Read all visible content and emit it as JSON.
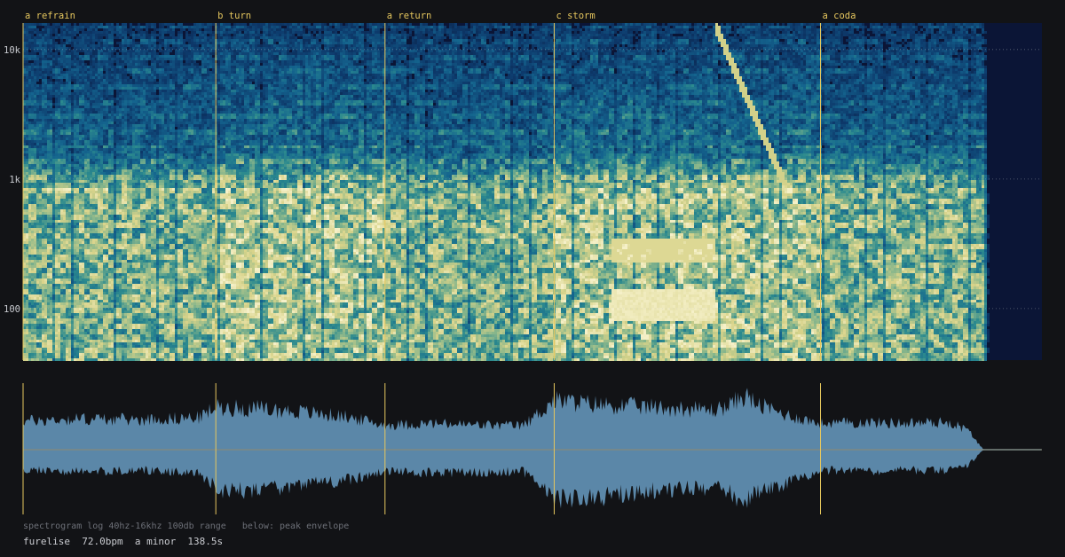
{
  "chart_data": [
    {
      "type": "heatmap",
      "colormap": [
        "#0a1a3c",
        "#0d3a6c",
        "#14648e",
        "#2c8a8e",
        "#8bb78b",
        "#d8d38a",
        "#f5f0c8"
      ],
      "x_range_seconds": [
        0,
        138.5
      ],
      "y_scale": "log",
      "y_range_hz": [
        40,
        16000
      ],
      "y_ticks": [
        {
          "value": 100,
          "label": "100"
        },
        {
          "value": 1000,
          "label": "1k"
        },
        {
          "value": 10000,
          "label": "10k"
        }
      ],
      "grid_lines_at_ticks": true,
      "segments": [
        {
          "label": "a refrain",
          "start": 0.0
        },
        {
          "label": "b turn",
          "start": 26.2
        },
        {
          "label": "a return",
          "start": 49.2
        },
        {
          "label": "c storm",
          "start": 72.2
        },
        {
          "label": "a coda",
          "start": 108.4
        }
      ],
      "audio_end_seconds": 130.5
    },
    {
      "type": "area",
      "x_range_seconds": [
        0,
        138.5
      ],
      "color": "#5b87a8",
      "envelope": {
        "x": [
          0,
          8,
          16,
          24,
          26.2,
          32,
          38,
          44,
          49.2,
          56,
          62,
          68,
          72.2,
          78,
          84,
          90,
          94,
          96,
          98,
          100,
          104,
          108.4,
          114,
          120,
          126,
          128.5,
          130.5,
          138.5
        ],
        "upper": [
          0.42,
          0.45,
          0.44,
          0.47,
          0.62,
          0.6,
          0.55,
          0.48,
          0.36,
          0.38,
          0.36,
          0.35,
          0.72,
          0.66,
          0.63,
          0.6,
          0.58,
          0.64,
          0.8,
          0.65,
          0.5,
          0.38,
          0.4,
          0.39,
          0.4,
          0.28,
          0.01,
          0.01
        ],
        "lower": [
          -0.3,
          -0.32,
          -0.3,
          -0.33,
          -0.58,
          -0.62,
          -0.5,
          -0.45,
          -0.32,
          -0.34,
          -0.33,
          -0.32,
          -0.72,
          -0.7,
          -0.62,
          -0.58,
          -0.56,
          -0.62,
          -0.78,
          -0.6,
          -0.48,
          -0.3,
          -0.32,
          -0.3,
          -0.31,
          -0.22,
          -0.01,
          -0.01
        ]
      }
    }
  ],
  "footer": {
    "caption": "spectrogram log 40hz-16khz 100db range   below: peak envelope",
    "track": "furelise  72.0bpm  a minor  138.5s"
  },
  "colors": {
    "background": "#121316",
    "segment_marker": "#e6c75e",
    "spectrogram_background": "#0b1536",
    "envelope_fill": "#5b87a8",
    "envelope_center": "#8f8a70"
  }
}
